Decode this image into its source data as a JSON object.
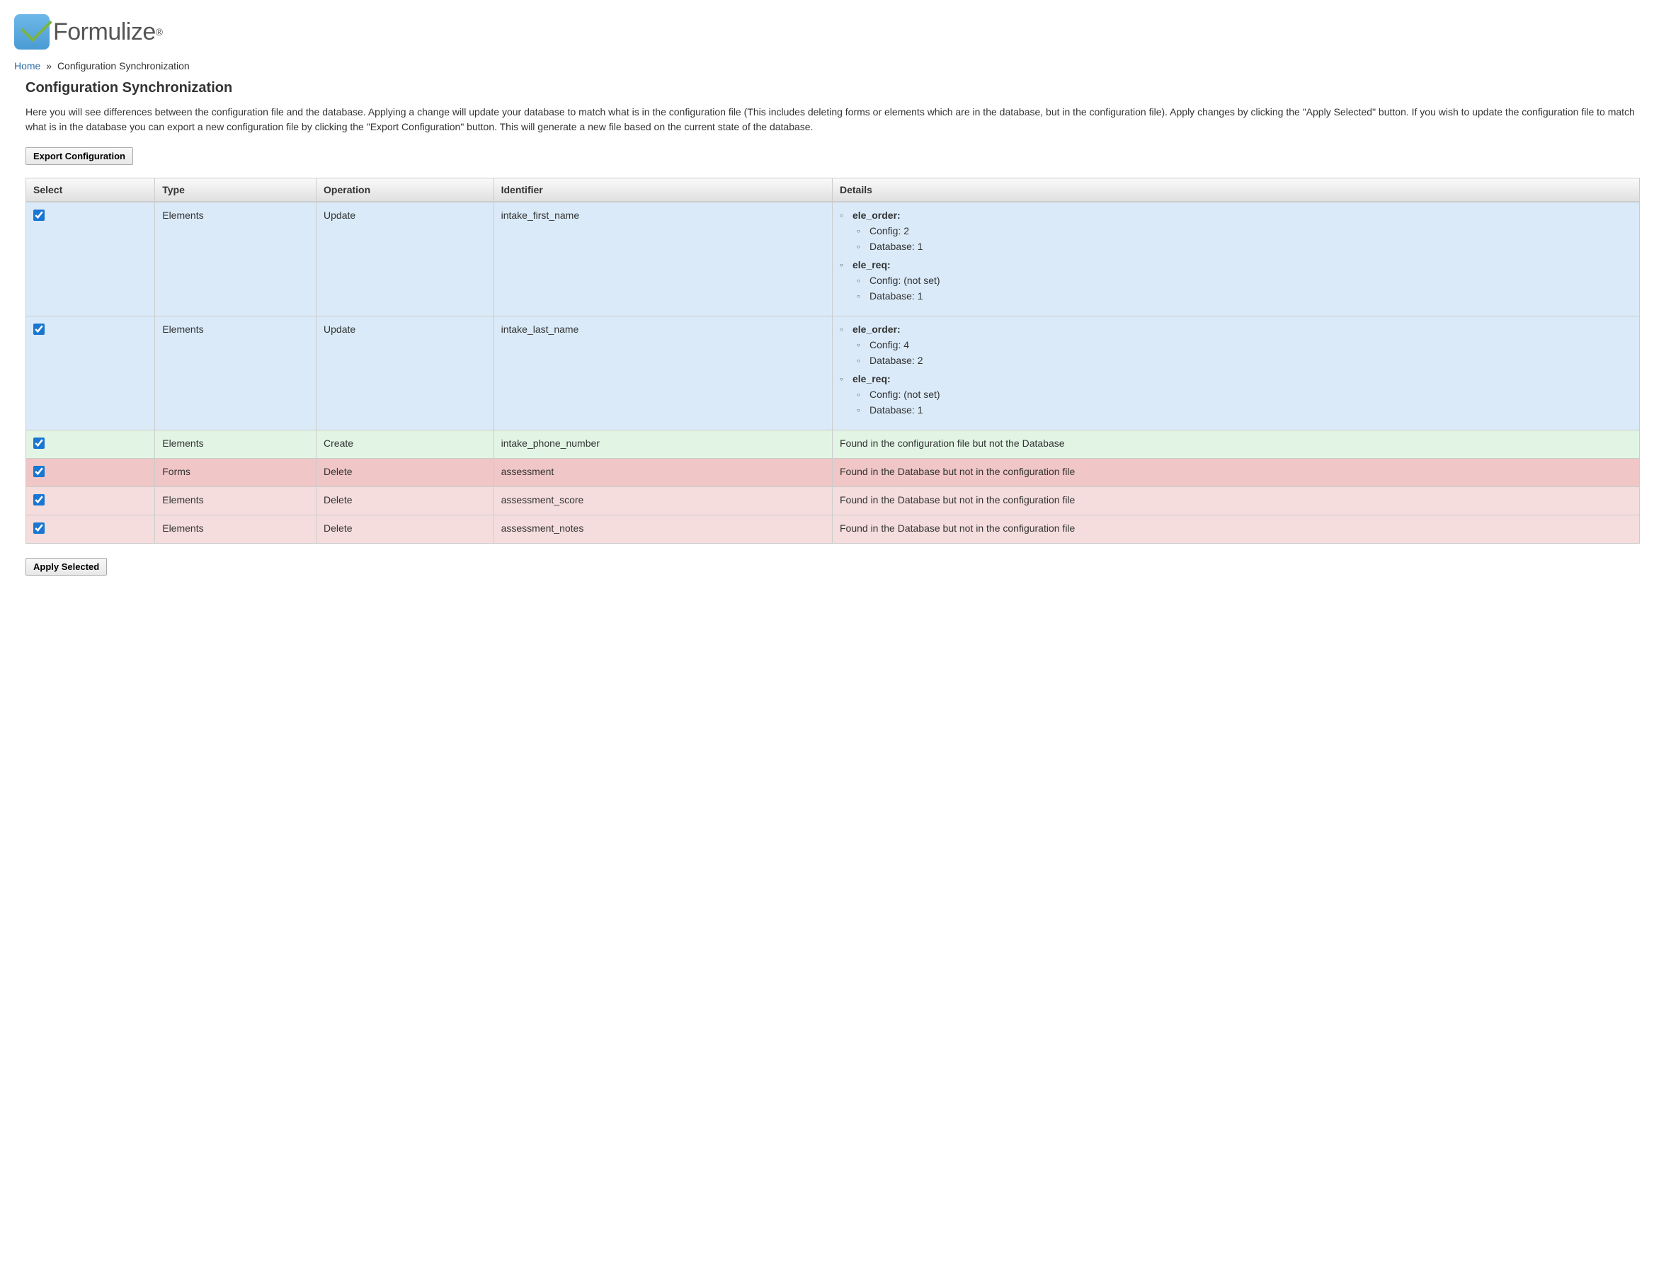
{
  "logo": {
    "text": "Formulize",
    "reg": "®"
  },
  "breadcrumb": {
    "home_label": "Home",
    "separator": "»",
    "current": "Configuration Synchronization"
  },
  "page": {
    "title": "Configuration Synchronization",
    "description": "Here you will see differences between the configuration file and the database. Applying a change will update your database to match what is in the configuration file (This includes deleting forms or elements which are in the database, but in the configuration file). Apply changes by clicking the \"Apply Selected\" button. If you wish to update the configuration file to match what is in the database you can export a new configuration file by clicking the \"Export Configuration\" button. This will generate a new file based on the current state of the database."
  },
  "buttons": {
    "export_label": "Export Configuration",
    "apply_label": "Apply Selected"
  },
  "table": {
    "headers": {
      "select": "Select",
      "type": "Type",
      "operation": "Operation",
      "identifier": "Identifier",
      "details": "Details"
    },
    "rows": [
      {
        "row_class": "row-update",
        "checked": true,
        "type": "Elements",
        "operation": "Update",
        "identifier": "intake_first_name",
        "details_type": "diff",
        "diffs": [
          {
            "key": "ele_order:",
            "config": "Config: 2",
            "database": "Database: 1"
          },
          {
            "key": "ele_req:",
            "config": "Config: (not set)",
            "database": "Database: 1"
          }
        ]
      },
      {
        "row_class": "row-update",
        "checked": true,
        "type": "Elements",
        "operation": "Update",
        "identifier": "intake_last_name",
        "details_type": "diff",
        "diffs": [
          {
            "key": "ele_order:",
            "config": "Config: 4",
            "database": "Database: 2"
          },
          {
            "key": "ele_req:",
            "config": "Config: (not set)",
            "database": "Database: 1"
          }
        ]
      },
      {
        "row_class": "row-create",
        "checked": true,
        "type": "Elements",
        "operation": "Create",
        "identifier": "intake_phone_number",
        "details_type": "text",
        "details_text": "Found in the configuration file but not the Database"
      },
      {
        "row_class": "row-delete-1",
        "checked": true,
        "type": "Forms",
        "operation": "Delete",
        "identifier": "assessment",
        "details_type": "text",
        "details_text": "Found in the Database but not in the configuration file"
      },
      {
        "row_class": "row-delete-2",
        "checked": true,
        "type": "Elements",
        "operation": "Delete",
        "identifier": "assessment_score",
        "details_type": "text",
        "details_text": "Found in the Database but not in the configuration file"
      },
      {
        "row_class": "row-delete-2",
        "checked": true,
        "type": "Elements",
        "operation": "Delete",
        "identifier": "assessment_notes",
        "details_type": "text",
        "details_text": "Found in the Database but not in the configuration file"
      }
    ]
  }
}
